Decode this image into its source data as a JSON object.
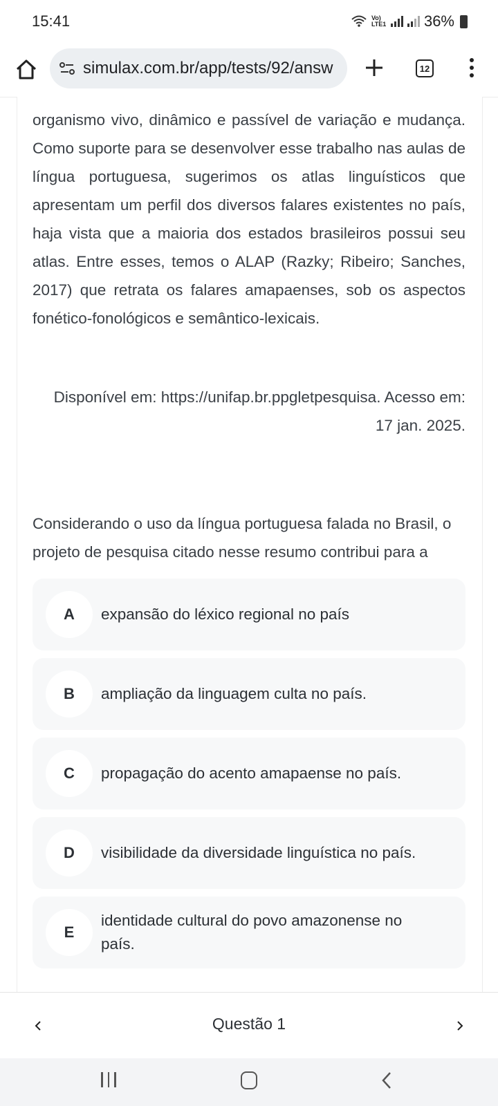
{
  "status_bar": {
    "time": "15:41",
    "network_label": "Vo) LTE1",
    "battery": "36%"
  },
  "browser": {
    "url": "simulax.com.br/app/tests/92/answ",
    "tab_count": "12"
  },
  "passage": {
    "text": "organismo vivo, dinâmico e passível de variação e mudança. Como suporte para se desenvolver esse trabalho nas aulas de língua portuguesa, sugerimos os atlas linguísticos que apresentam um perfil dos diversos falares existentes no país, haja vista que a maioria dos estados brasileiros possui seu atlas. Entre esses, temos o ALAP (Razky; Ribeiro; Sanches, 2017) que retrata os falares amapaenses, sob os aspectos fonético-fonológicos e semântico-lexicais.",
    "citation": "Disponível em: https://unifap.br.ppgletpesquisa. Acesso em: 17 jan. 2025."
  },
  "question": {
    "prompt": "Considerando o uso da língua portuguesa falada no Brasil, o projeto de pesquisa citado nesse resumo contribui para a",
    "options": [
      {
        "letter": "A",
        "text": "expansão do léxico regional no país"
      },
      {
        "letter": "B",
        "text": "ampliação da linguagem culta no país."
      },
      {
        "letter": "C",
        "text": "propagação do acento amapaense no país."
      },
      {
        "letter": "D",
        "text": "visibilidade da diversidade linguística no país."
      },
      {
        "letter": "E",
        "text": "identidade cultural do povo amazonense no país."
      }
    ]
  },
  "navigation": {
    "label": "Questão 1"
  }
}
